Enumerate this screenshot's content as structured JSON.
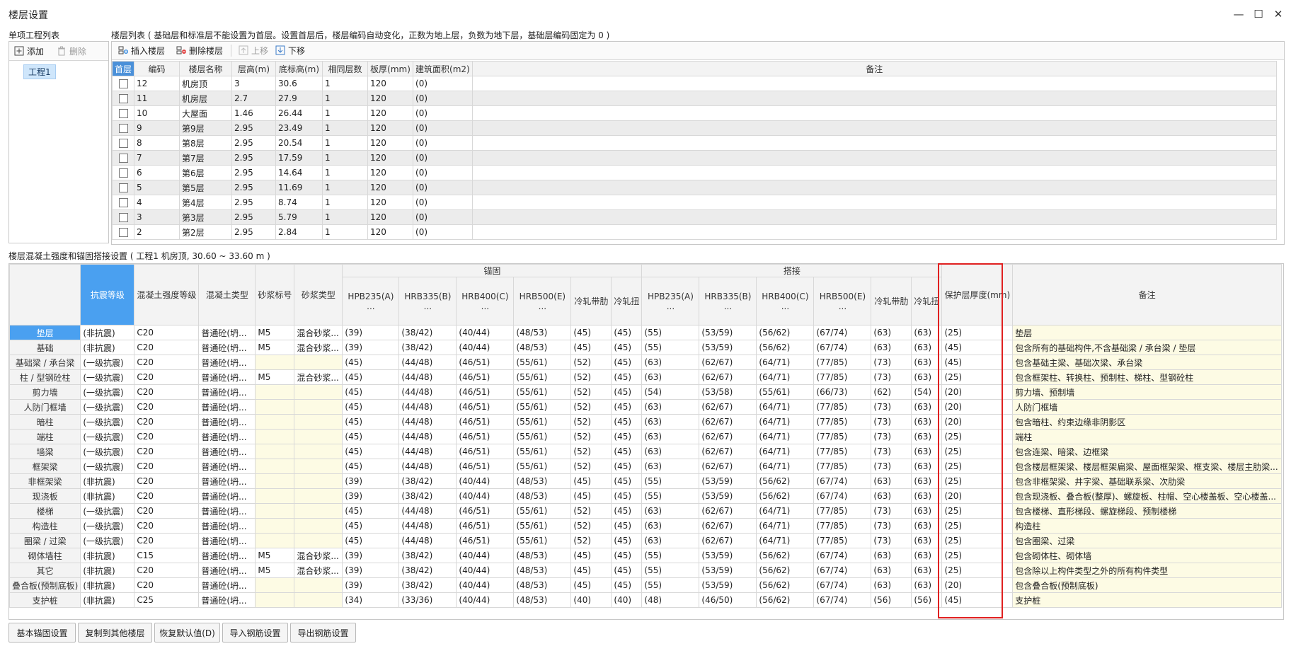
{
  "window": {
    "title": "楼层设置",
    "minimize": "—",
    "maximize": "☐",
    "close": "✕"
  },
  "project_list": {
    "label": "单项工程列表",
    "add_label": "添加",
    "delete_label": "删除",
    "items": [
      "工程1"
    ]
  },
  "floor_list": {
    "label": "楼层列表 ( 基础层和标准层不能设置为首层。设置首层后，楼层编码自动变化，正数为地上层，负数为地下层，基础层编码固定为 0 )",
    "toolbar": {
      "insert": "插入楼层",
      "delete": "删除楼层",
      "up": "上移",
      "down": "下移"
    },
    "columns": [
      "首层",
      "编码",
      "楼层名称",
      "层高(m)",
      "底标高(m)",
      "相同层数",
      "板厚(mm)",
      "建筑面积(m2)",
      "备注"
    ],
    "rows": [
      [
        "12",
        "机房顶",
        "3",
        "30.6",
        "1",
        "120",
        "(0)",
        ""
      ],
      [
        "11",
        "机房层",
        "2.7",
        "27.9",
        "1",
        "120",
        "(0)",
        ""
      ],
      [
        "10",
        "大屋面",
        "1.46",
        "26.44",
        "1",
        "120",
        "(0)",
        ""
      ],
      [
        "9",
        "第9层",
        "2.95",
        "23.49",
        "1",
        "120",
        "(0)",
        ""
      ],
      [
        "8",
        "第8层",
        "2.95",
        "20.54",
        "1",
        "120",
        "(0)",
        ""
      ],
      [
        "7",
        "第7层",
        "2.95",
        "17.59",
        "1",
        "120",
        "(0)",
        ""
      ],
      [
        "6",
        "第6层",
        "2.95",
        "14.64",
        "1",
        "120",
        "(0)",
        ""
      ],
      [
        "5",
        "第5层",
        "2.95",
        "11.69",
        "1",
        "120",
        "(0)",
        ""
      ],
      [
        "4",
        "第4层",
        "2.95",
        "8.74",
        "1",
        "120",
        "(0)",
        ""
      ],
      [
        "3",
        "第3层",
        "2.95",
        "5.79",
        "1",
        "120",
        "(0)",
        ""
      ],
      [
        "2",
        "第2层",
        "2.95",
        "2.84",
        "1",
        "120",
        "(0)",
        ""
      ]
    ]
  },
  "concrete": {
    "label": "楼层混凝土强度和锚固搭接设置 ( 工程1  机房顶, 30.60 ~ 33.60 m )",
    "group_anchor": "锚固",
    "group_lap": "搭接",
    "columns": [
      "抗震等级",
      "混凝土强度等级",
      "混凝土类型",
      "砂浆标号",
      "砂浆类型",
      "HPB235(A)\n...",
      "HRB335(B)\n...",
      "HRB400(C)\n...",
      "HRB500(E)\n...",
      "冷轧带肋",
      "冷轧扭",
      "HPB235(A)\n...",
      "HRB335(B)\n...",
      "HRB400(C)\n...",
      "HRB500(E)\n...",
      "冷轧带肋",
      "冷轧扭",
      "保护层厚度(mm)",
      "备注"
    ],
    "rows": [
      [
        "垫层",
        "(非抗震)",
        "C20",
        "普通砼(坍...",
        "M5",
        "混合砂浆...",
        "(39)",
        "(38/42)",
        "(40/44)",
        "(48/53)",
        "(45)",
        "(45)",
        "(55)",
        "(53/59)",
        "(56/62)",
        "(67/74)",
        "(63)",
        "(63)",
        "(25)",
        "垫层"
      ],
      [
        "基础",
        "(非抗震)",
        "C20",
        "普通砼(坍...",
        "M5",
        "混合砂浆...",
        "(39)",
        "(38/42)",
        "(40/44)",
        "(48/53)",
        "(45)",
        "(45)",
        "(55)",
        "(53/59)",
        "(56/62)",
        "(67/74)",
        "(63)",
        "(63)",
        "(45)",
        "包含所有的基础构件,不含基础梁 / 承台梁 / 垫层"
      ],
      [
        "基础梁 / 承台梁",
        "(一级抗震)",
        "C20",
        "普通砼(坍...",
        "",
        "",
        "(45)",
        "(44/48)",
        "(46/51)",
        "(55/61)",
        "(52)",
        "(45)",
        "(63)",
        "(62/67)",
        "(64/71)",
        "(77/85)",
        "(73)",
        "(63)",
        "(45)",
        "包含基础主梁、基础次梁、承台梁"
      ],
      [
        "柱 / 型钢砼柱",
        "(一级抗震)",
        "C20",
        "普通砼(坍...",
        "M5",
        "混合砂浆...",
        "(45)",
        "(44/48)",
        "(46/51)",
        "(55/61)",
        "(52)",
        "(45)",
        "(63)",
        "(62/67)",
        "(64/71)",
        "(77/85)",
        "(73)",
        "(63)",
        "(25)",
        "包含框架柱、转换柱、预制柱、梯柱、型钢砼柱"
      ],
      [
        "剪力墙",
        "(一级抗震)",
        "C20",
        "普通砼(坍...",
        "",
        "",
        "(45)",
        "(44/48)",
        "(46/51)",
        "(55/61)",
        "(52)",
        "(45)",
        "(54)",
        "(53/58)",
        "(55/61)",
        "(66/73)",
        "(62)",
        "(54)",
        "(20)",
        "剪力墙、预制墙"
      ],
      [
        "人防门框墙",
        "(一级抗震)",
        "C20",
        "普通砼(坍...",
        "",
        "",
        "(45)",
        "(44/48)",
        "(46/51)",
        "(55/61)",
        "(52)",
        "(45)",
        "(63)",
        "(62/67)",
        "(64/71)",
        "(77/85)",
        "(73)",
        "(63)",
        "(20)",
        "人防门框墙"
      ],
      [
        "暗柱",
        "(一级抗震)",
        "C20",
        "普通砼(坍...",
        "",
        "",
        "(45)",
        "(44/48)",
        "(46/51)",
        "(55/61)",
        "(52)",
        "(45)",
        "(63)",
        "(62/67)",
        "(64/71)",
        "(77/85)",
        "(73)",
        "(63)",
        "(20)",
        "包含暗柱、约束边缘非阴影区"
      ],
      [
        "端柱",
        "(一级抗震)",
        "C20",
        "普通砼(坍...",
        "",
        "",
        "(45)",
        "(44/48)",
        "(46/51)",
        "(55/61)",
        "(52)",
        "(45)",
        "(63)",
        "(62/67)",
        "(64/71)",
        "(77/85)",
        "(73)",
        "(63)",
        "(25)",
        "端柱"
      ],
      [
        "墙梁",
        "(一级抗震)",
        "C20",
        "普通砼(坍...",
        "",
        "",
        "(45)",
        "(44/48)",
        "(46/51)",
        "(55/61)",
        "(52)",
        "(45)",
        "(63)",
        "(62/67)",
        "(64/71)",
        "(77/85)",
        "(73)",
        "(63)",
        "(25)",
        "包含连梁、暗梁、边框梁"
      ],
      [
        "框架梁",
        "(一级抗震)",
        "C20",
        "普通砼(坍...",
        "",
        "",
        "(45)",
        "(44/48)",
        "(46/51)",
        "(55/61)",
        "(52)",
        "(45)",
        "(63)",
        "(62/67)",
        "(64/71)",
        "(77/85)",
        "(73)",
        "(63)",
        "(25)",
        "包含楼层框架梁、楼层框架扁梁、屋面框架梁、框支梁、楼层主肋梁..."
      ],
      [
        "非框架梁",
        "(非抗震)",
        "C20",
        "普通砼(坍...",
        "",
        "",
        "(39)",
        "(38/42)",
        "(40/44)",
        "(48/53)",
        "(45)",
        "(45)",
        "(55)",
        "(53/59)",
        "(56/62)",
        "(67/74)",
        "(63)",
        "(63)",
        "(25)",
        "包含非框架梁、井字梁、基础联系梁、次肋梁"
      ],
      [
        "现浇板",
        "(非抗震)",
        "C20",
        "普通砼(坍...",
        "",
        "",
        "(39)",
        "(38/42)",
        "(40/44)",
        "(48/53)",
        "(45)",
        "(45)",
        "(55)",
        "(53/59)",
        "(56/62)",
        "(67/74)",
        "(63)",
        "(63)",
        "(20)",
        "包含现浇板、叠合板(整厚)、螺旋板、柱帽、空心楼盖板、空心楼盖..."
      ],
      [
        "楼梯",
        "(一级抗震)",
        "C20",
        "普通砼(坍...",
        "",
        "",
        "(45)",
        "(44/48)",
        "(46/51)",
        "(55/61)",
        "(52)",
        "(45)",
        "(63)",
        "(62/67)",
        "(64/71)",
        "(77/85)",
        "(73)",
        "(63)",
        "(25)",
        "包含楼梯、直形梯段、螺旋梯段、预制楼梯"
      ],
      [
        "构造柱",
        "(一级抗震)",
        "C20",
        "普通砼(坍...",
        "",
        "",
        "(45)",
        "(44/48)",
        "(46/51)",
        "(55/61)",
        "(52)",
        "(45)",
        "(63)",
        "(62/67)",
        "(64/71)",
        "(77/85)",
        "(73)",
        "(63)",
        "(25)",
        "构造柱"
      ],
      [
        "圈梁 / 过梁",
        "(一级抗震)",
        "C20",
        "普通砼(坍...",
        "",
        "",
        "(45)",
        "(44/48)",
        "(46/51)",
        "(55/61)",
        "(52)",
        "(45)",
        "(63)",
        "(62/67)",
        "(64/71)",
        "(77/85)",
        "(73)",
        "(63)",
        "(25)",
        "包含圈梁、过梁"
      ],
      [
        "砌体墙柱",
        "(非抗震)",
        "C15",
        "普通砼(坍...",
        "M5",
        "混合砂浆...",
        "(39)",
        "(38/42)",
        "(40/44)",
        "(48/53)",
        "(45)",
        "(45)",
        "(55)",
        "(53/59)",
        "(56/62)",
        "(67/74)",
        "(63)",
        "(63)",
        "(25)",
        "包含砌体柱、砌体墙"
      ],
      [
        "其它",
        "(非抗震)",
        "C20",
        "普通砼(坍...",
        "M5",
        "混合砂浆...",
        "(39)",
        "(38/42)",
        "(40/44)",
        "(48/53)",
        "(45)",
        "(45)",
        "(55)",
        "(53/59)",
        "(56/62)",
        "(67/74)",
        "(63)",
        "(63)",
        "(25)",
        "包含除以上构件类型之外的所有构件类型"
      ],
      [
        "叠合板(预制底板)",
        "(非抗震)",
        "C20",
        "普通砼(坍...",
        "",
        "",
        "(39)",
        "(38/42)",
        "(40/44)",
        "(48/53)",
        "(45)",
        "(45)",
        "(55)",
        "(53/59)",
        "(56/62)",
        "(67/74)",
        "(63)",
        "(63)",
        "(20)",
        "包含叠合板(预制底板)"
      ],
      [
        "支护桩",
        "(非抗震)",
        "C25",
        "普通砼(坍...",
        "",
        "",
        "(34)",
        "(33/36)",
        "(40/44)",
        "(48/53)",
        "(40)",
        "(40)",
        "(48)",
        "(46/50)",
        "(56/62)",
        "(67/74)",
        "(56)",
        "(56)",
        "(45)",
        "支护桩"
      ]
    ]
  },
  "buttons": [
    "基本锚固设置",
    "复制到其他楼层",
    "恢复默认值(D)",
    "导入钢筋设置",
    "导出钢筋设置"
  ],
  "colors": {
    "selected_header": "#4aa0f0",
    "highlight_box": "#e02020",
    "note_bg": "#fdfbe4"
  }
}
